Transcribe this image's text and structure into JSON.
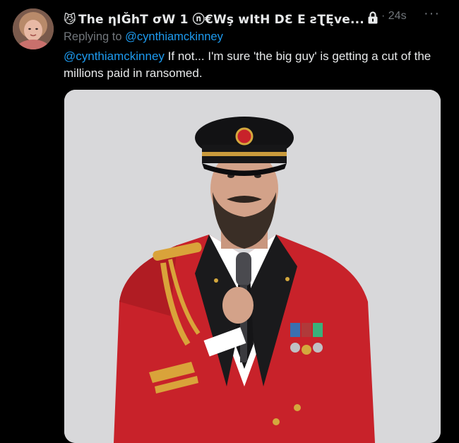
{
  "tweet": {
    "emoji": "😼",
    "display_name": "The ηIĞhT σW 1 ⓝ€Wş wItH DƐ E  ƨƮĘve...",
    "time": "· 24s",
    "more_icon": "ellipsis-icon",
    "lock_icon": "lock-icon",
    "replying_to_prefix": "Replying to ",
    "replying_to_handle": "@cynthiamckinney",
    "text_mention": "@cynthiamckinney",
    "text_body": " If not... I'm sure 'the big guy' is getting a cut of the millions paid in ransomed.",
    "colors": {
      "background": "#000000",
      "primary_text": "#e7e9ea",
      "secondary_text": "#71767b",
      "link": "#1d9bf0",
      "jacket_red": "#c8222a"
    }
  }
}
